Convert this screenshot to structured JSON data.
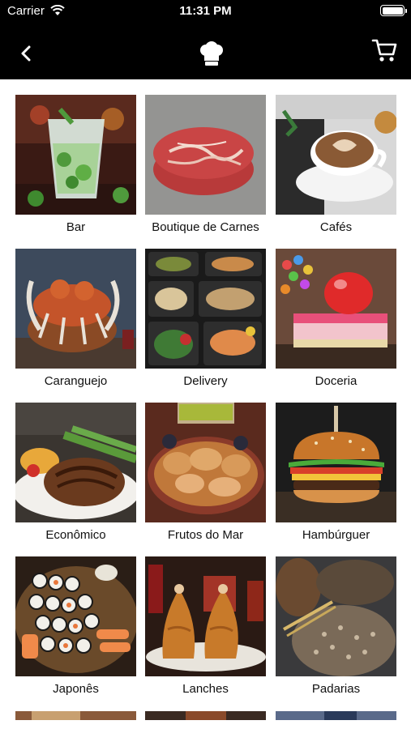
{
  "status_bar": {
    "carrier": "Carrier",
    "time": "11:31 PM"
  },
  "nav": {
    "back_icon": "chevron-left-icon",
    "center_icon": "chef-hat-icon",
    "cart_icon": "shopping-cart-icon"
  },
  "categories": [
    {
      "label": "Bar"
    },
    {
      "label": "Boutique de Carnes"
    },
    {
      "label": "Cafés"
    },
    {
      "label": "Caranguejo"
    },
    {
      "label": "Delivery"
    },
    {
      "label": "Doceria"
    },
    {
      "label": "Econômico"
    },
    {
      "label": "Frutos do Mar"
    },
    {
      "label": "Hambúrguer"
    },
    {
      "label": "Japonês"
    },
    {
      "label": "Lanches"
    },
    {
      "label": "Padarias"
    }
  ]
}
